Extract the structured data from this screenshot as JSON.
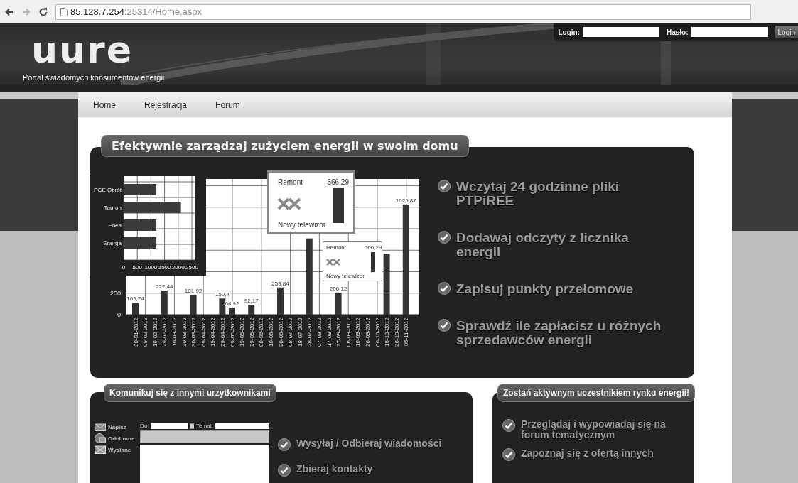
{
  "browser": {
    "url_host": "85.128.7.254",
    "url_path": ":25314/Home.aspx"
  },
  "header": {
    "logo": "uure",
    "tagline": "Portal świadomych konsumentów energii",
    "login_label": "Login:",
    "password_label": "Hasło:",
    "login_button": "Login"
  },
  "nav": [
    {
      "label": "Home"
    },
    {
      "label": "Rejestracja"
    },
    {
      "label": "Forum"
    }
  ],
  "energy_panel": {
    "title": "Efektywnie zarządzaj zużyciem energii w swoim domu",
    "chart_data": {
      "type": "bar",
      "orientation": "vertical",
      "grid": true,
      "categories": [
        "30-01-2012",
        "09-02-2012",
        "19-02-2012",
        "29-02-2012",
        "10-03-2012",
        "20-03-2012",
        "30-03-2012",
        "09-04-2012",
        "19-04-2012",
        "29-04-2012",
        "09-05-2012",
        "19-05-2012",
        "29-05-2012",
        "08-06-2012",
        "18-06-2012",
        "28-06-2012",
        "08-07-2012",
        "18-07-2012",
        "28-07-2012",
        "07-08-2012",
        "17-08-2012",
        "27-08-2012",
        "06-09-2012",
        "16-09-2012",
        "26-09-2012",
        "06-10-2012",
        "16-10-2012",
        "26-10-2012",
        "05-11-2012"
      ],
      "values": [
        109.24,
        null,
        null,
        222.44,
        null,
        null,
        181.92,
        null,
        null,
        150.4,
        64.92,
        null,
        92.17,
        null,
        null,
        253.84,
        null,
        null,
        710,
        null,
        null,
        206.12,
        null,
        null,
        null,
        null,
        566.29,
        null,
        1025.87
      ],
      "value_labels": [
        "109,24",
        null,
        null,
        "222,44",
        null,
        null,
        "181,92",
        null,
        null,
        "150,4",
        "64,92",
        null,
        "92,17",
        null,
        null,
        "253,84",
        null,
        null,
        null,
        null,
        null,
        "206,12",
        null,
        null,
        null,
        null,
        null,
        null,
        "1025,87"
      ],
      "ylim": [
        0,
        1250
      ],
      "yticks": [
        0,
        200
      ]
    },
    "inset_chart": {
      "chart_data": {
        "type": "bar",
        "orientation": "horizontal",
        "grid": true,
        "categories": [
          "PGE Obrót",
          "Tauron",
          "Enea",
          "Energa"
        ],
        "values": [
          1200,
          2100,
          1200,
          1200
        ],
        "xlim": [
          0,
          2500
        ],
        "xticks": [
          0,
          500,
          1000,
          1500,
          2000,
          2500
        ]
      }
    },
    "callouts": [
      {
        "kind": "zoom",
        "title": "Remont",
        "value": "566,29",
        "note": "Nowy telewizor"
      },
      {
        "kind": "marker",
        "title": "Remont",
        "value": "566,29",
        "note": "Nowy telewizor"
      }
    ],
    "features": [
      "Wczytaj 24 godzinne pliki PTPiREE",
      "Dodawaj odczyty z licznika energii",
      "Zapisuj punkty przełomowe",
      "Sprawdź ile zapłacisz u różnych sprzedawców energii"
    ]
  },
  "messages_panel": {
    "title": "Komunikuj się z innymi urzytkownikami",
    "folders": [
      {
        "kind": "compose",
        "label": "Napisz"
      },
      {
        "kind": "inbox",
        "label": "Odebrane"
      },
      {
        "kind": "sent",
        "label": "Wysłane"
      }
    ],
    "editor": {
      "to_label": "Do:",
      "subject_label": "Temat:"
    },
    "features": [
      "Wysyłaj / Odbieraj wiadomości",
      "Zbieraj kontakty"
    ]
  },
  "market_panel": {
    "title": "Zostań aktywnym uczestnikiem rynku energii!",
    "features": [
      "Przeglądaj i wypowiadaj się na forum tematycznym",
      "Zapoznaj się z ofertą innych"
    ]
  }
}
